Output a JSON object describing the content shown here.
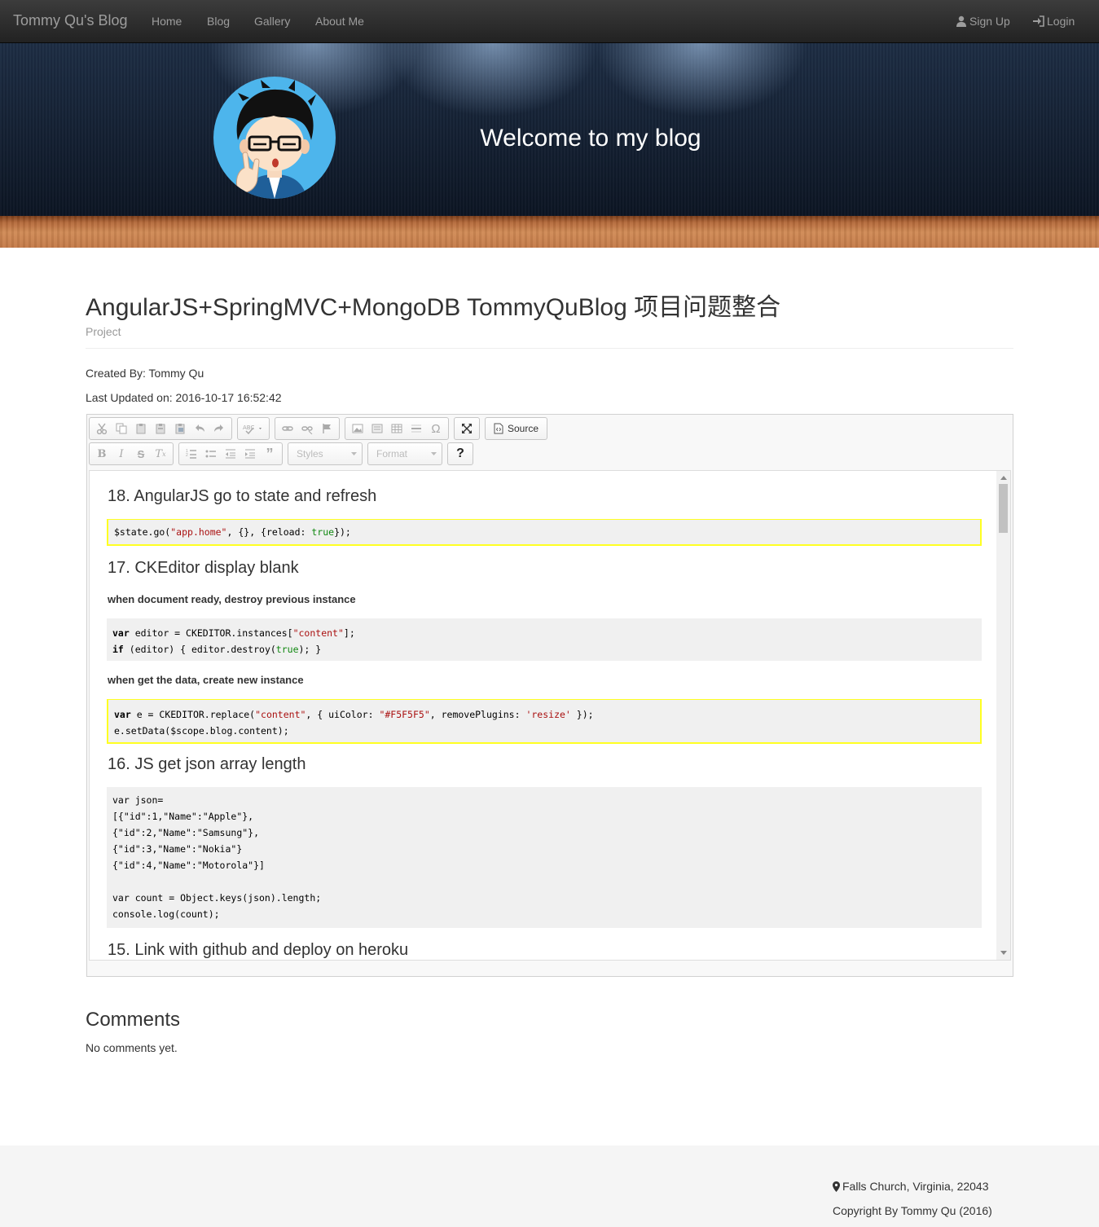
{
  "nav": {
    "brand": "Tommy Qu's Blog",
    "links": [
      "Home",
      "Blog",
      "Gallery",
      "About Me"
    ],
    "signup": "Sign Up",
    "login": "Login"
  },
  "hero": {
    "title": "Welcome to my blog"
  },
  "post": {
    "title": "AngularJS+SpringMVC+MongoDB TommyQuBlog 项目问题整合",
    "category": "Project",
    "created_by": "Created By: Tommy Qu",
    "last_updated": "Last Updated on: 2016-10-17 16:52:42"
  },
  "editor": {
    "toolbar": {
      "styles_label": "Styles",
      "format_label": "Format",
      "source_label": "Source",
      "help_label": "?"
    },
    "sections": [
      {
        "heading": "18. AngularJS go to state and refresh"
      },
      {
        "heading": "17. CKEditor display blank",
        "sub1": "when document ready, destroy previous instance",
        "sub2": "when get the data, create new instance"
      },
      {
        "heading": "16. JS get json array length"
      },
      {
        "heading": "15. Link with github and deploy on heroku"
      }
    ],
    "code": {
      "state_go": {
        "a": "$state.go(",
        "b": "\"app.home\"",
        "c": ", {}, {reload: ",
        "d": "true",
        "e": "});"
      },
      "destroy": {
        "l1a": "var",
        "l1b": " editor = CKEDITOR.instances[",
        "l1c": "\"content\"",
        "l1d": "];",
        "l2a": "if",
        "l2b": " (editor) { editor.destroy(",
        "l2c": "true",
        "l2d": "); }"
      },
      "replace": {
        "l1a": "var",
        "l1b": " e = CKEDITOR.replace(",
        "l1c": "\"content\"",
        "l1d": ", { uiColor: ",
        "l1e": "\"#F5F5F5\"",
        "l1f": ", removePlugins: ",
        "l1g": "'resize'",
        "l1h": " });",
        "l2": "e.setData($scope.blog.content);"
      },
      "json_lines": [
        "var json=",
        "[{\"id\":1,\"Name\":\"Apple\"},",
        "{\"id\":2,\"Name\":\"Samsung\"},",
        "{\"id\":3,\"Name\":\"Nokia\"}",
        "{\"id\":4,\"Name\":\"Motorola\"}]",
        "",
        "var count = Object.keys(json).length;",
        "console.log(count);"
      ]
    }
  },
  "comments": {
    "title": "Comments",
    "empty": "No comments yet."
  },
  "footer": {
    "address": "Falls Church, Virginia, 22043",
    "copyright": "Copyright By Tommy Qu (2016)"
  }
}
